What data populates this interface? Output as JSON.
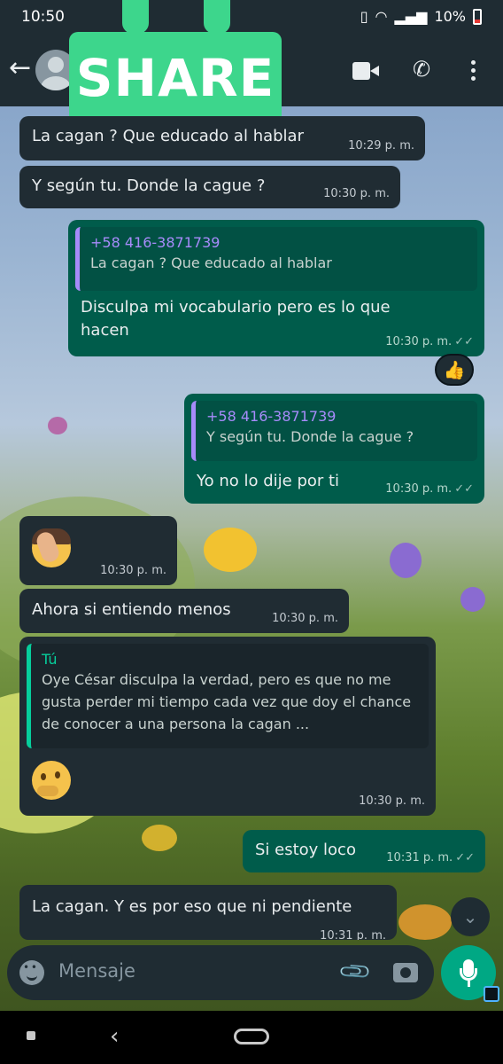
{
  "status_bar": {
    "time": "10:50",
    "battery": "10%"
  },
  "sticker": {
    "label": "SHARE"
  },
  "messages": [
    {
      "text": "La cagan ? Que educado al hablar",
      "time": "10:29 p. m."
    },
    {
      "text": "Y según tu.  Donde la cague ?",
      "time": "10:30 p. m."
    },
    {
      "quote_name": "+58 416-3871739",
      "quote_text": "La cagan ? Que educado al hablar",
      "text": "Disculpa mi vocabulario pero es lo que hacen",
      "time": "10:30 p. m.",
      "reaction": "👍"
    },
    {
      "quote_name": "+58 416-3871739",
      "quote_text": "Y según tu.  Donde la cague ?",
      "text": "Yo no lo dije por ti",
      "time": "10:30 p. m."
    },
    {
      "emoji": "facepalm",
      "time": "10:30 p. m."
    },
    {
      "text": "Ahora si entiendo menos",
      "time": "10:30 p. m."
    },
    {
      "quote_name": "Tú",
      "quote_text": "Oye César disculpa la verdad, pero es que no me gusta perder mi tiempo cada vez que doy el chance de conocer a una persona la cagan ...",
      "emoji": "thinking",
      "time": "10:30 p. m."
    },
    {
      "text": "Si estoy loco",
      "time": "10:31 p. m."
    },
    {
      "text": "La cagan. Y es por eso que ni pendiente",
      "time": "10:31 p. m."
    }
  ],
  "input": {
    "placeholder": "Mensaje"
  },
  "colors": {
    "incoming": "#202c33",
    "outgoing": "#005c4b",
    "accent": "#00a884",
    "share": "#3dd68c"
  }
}
